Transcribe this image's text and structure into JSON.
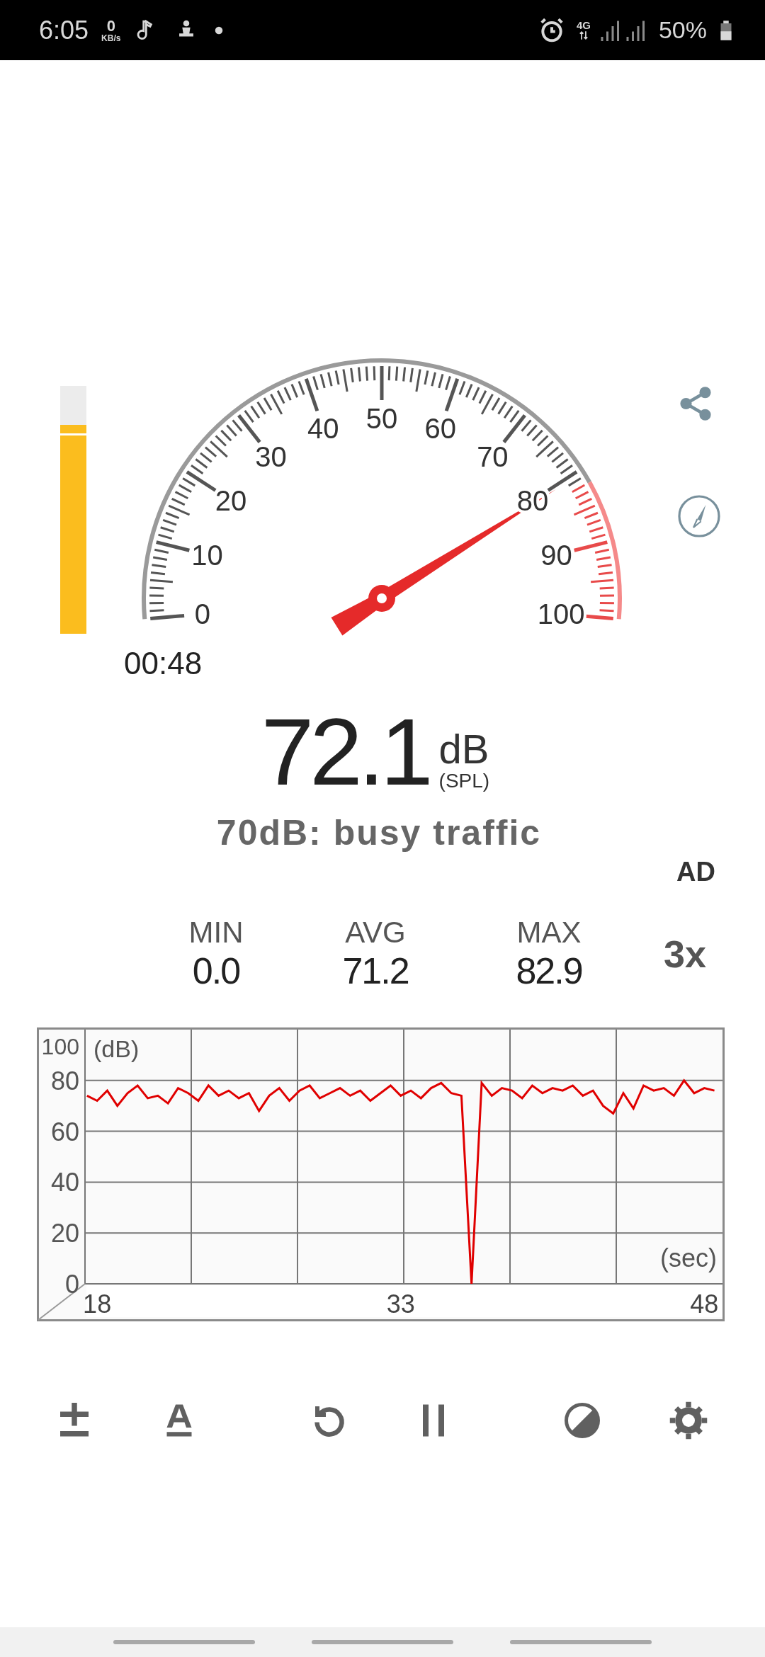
{
  "status_bar": {
    "time": "6:05",
    "net_speed_value": "0",
    "net_speed_unit": "KB/s",
    "network": "4G",
    "battery": "50%"
  },
  "level_meter": {
    "level": 0.81
  },
  "gauge": {
    "labels": [
      "0",
      "10",
      "20",
      "30",
      "40",
      "50",
      "60",
      "70",
      "80",
      "90",
      "100"
    ],
    "elapsed": "00:48"
  },
  "reading": {
    "value": "72.1",
    "unit": "dB",
    "weighting": "(SPL)",
    "description": "70dB: busy traffic"
  },
  "ad_label": "AD",
  "stats": [
    {
      "label": "MIN",
      "value": "0.0"
    },
    {
      "label": "AVG",
      "value": "71.2"
    },
    {
      "label": "MAX",
      "value": "82.9"
    }
  ],
  "speed": "3x",
  "chart": {
    "chart_data": {
      "type": "line",
      "grid": true,
      "ylabel": "(dB)",
      "xlabel": "(sec)",
      "ylim": [
        0,
        100
      ],
      "xlim": [
        17.4,
        48.9
      ],
      "yticks": [
        0,
        20,
        40,
        60,
        80,
        100
      ],
      "xticks": [
        18,
        33,
        48
      ],
      "x": [
        17.5,
        18,
        18.5,
        19,
        19.5,
        20,
        20.5,
        21,
        21.5,
        22,
        22.5,
        23,
        23.5,
        24,
        24.5,
        25,
        25.5,
        26,
        26.5,
        27,
        27.5,
        28,
        28.5,
        29,
        29.5,
        30,
        30.5,
        31,
        31.5,
        32,
        32.5,
        33,
        33.5,
        34,
        34.5,
        35,
        35.5,
        36,
        36.5,
        37,
        37.5,
        38,
        38.5,
        39,
        39.5,
        40,
        40.5,
        41,
        41.5,
        42,
        42.5,
        43,
        43.5,
        44,
        44.5,
        45,
        45.5,
        46,
        46.5,
        47,
        47.5,
        48,
        48.5
      ],
      "series": [
        {
          "color": "#e00000",
          "values": [
            74,
            72,
            76,
            70,
            75,
            78,
            73,
            74,
            71,
            77,
            75,
            72,
            78,
            74,
            76,
            73,
            75,
            68,
            74,
            77,
            72,
            76,
            78,
            73,
            75,
            77,
            74,
            76,
            72,
            75,
            78,
            74,
            76,
            73,
            77,
            79,
            75,
            74,
            0,
            79,
            74,
            77,
            76,
            73,
            78,
            75,
            77,
            76,
            78,
            74,
            76,
            70,
            67,
            75,
            69,
            78,
            76,
            77,
            74,
            80,
            75,
            77,
            76
          ]
        }
      ]
    }
  }
}
